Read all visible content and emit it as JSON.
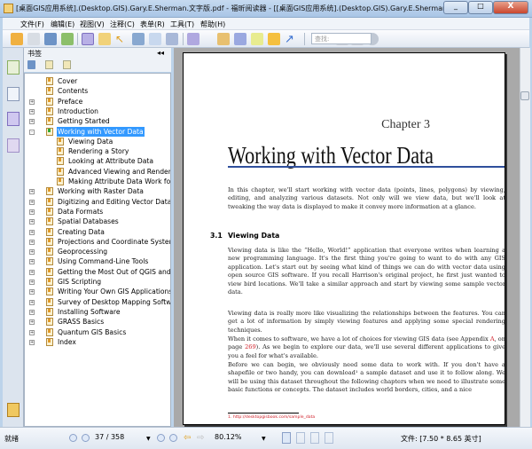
{
  "window": {
    "title": "[桌面GIS应用系统].(Desktop.GIS).Gary.E.Sherman.文字版.pdf - 福昕阅读器 - [[桌面GIS应用系统].(Desktop.GIS).Gary.E.Sherman.文字版.pdf]",
    "close": "X",
    "min": "_",
    "max": "□"
  },
  "menu": [
    "文件(F)",
    "编辑(E)",
    "视图(V)",
    "注释(C)",
    "表单(R)",
    "工具(T)",
    "帮助(H)"
  ],
  "toolbar": {
    "search_placeholder": "查找:",
    "icons": [
      "open-icon",
      "save-icon",
      "print-icon",
      "email-icon",
      "hand-icon",
      "select-text-icon",
      "select-icon",
      "find-icon",
      "typewriter-icon",
      "snapshot-icon",
      "pen-icon",
      "stamp-icon",
      "note-icon",
      "textbox-icon",
      "comment-icon",
      "arrow-icon",
      "find-prev-icon",
      "find-next-icon",
      "search-icon"
    ]
  },
  "bookmarks": {
    "title": "书签",
    "pin": "◂◂",
    "items": [
      {
        "label": "Cover",
        "level": 0,
        "expand": ""
      },
      {
        "label": "Contents",
        "level": 0,
        "expand": ""
      },
      {
        "label": "Preface",
        "level": 0,
        "expand": "+"
      },
      {
        "label": "Introduction",
        "level": 0,
        "expand": "+"
      },
      {
        "label": "Getting Started",
        "level": 0,
        "expand": "+"
      },
      {
        "label": "Working with Vector Data",
        "level": 0,
        "expand": "-",
        "selected": true
      },
      {
        "label": "Viewing Data",
        "level": 1,
        "expand": ""
      },
      {
        "label": "Rendering a Story",
        "level": 1,
        "expand": ""
      },
      {
        "label": "Looking at Attribute Data",
        "level": 1,
        "expand": ""
      },
      {
        "label": "Advanced Viewing and Rendering",
        "level": 1,
        "expand": ""
      },
      {
        "label": "Making Attribute Data Work for You",
        "level": 1,
        "expand": ""
      },
      {
        "label": "Working with Raster Data",
        "level": 0,
        "expand": "+"
      },
      {
        "label": "Digitizing and Editing Vector Data",
        "level": 0,
        "expand": "+"
      },
      {
        "label": "Data Formats",
        "level": 0,
        "expand": "+"
      },
      {
        "label": "Spatial Databases",
        "level": 0,
        "expand": "+"
      },
      {
        "label": "Creating Data",
        "level": 0,
        "expand": "+"
      },
      {
        "label": "Projections and Coordinate Systems",
        "level": 0,
        "expand": "+"
      },
      {
        "label": "Geoprocessing",
        "level": 0,
        "expand": "+"
      },
      {
        "label": "Using Command-Line Tools",
        "level": 0,
        "expand": "+"
      },
      {
        "label": "Getting the Most Out of QGIS and GRASS",
        "level": 0,
        "expand": "+"
      },
      {
        "label": "GIS Scripting",
        "level": 0,
        "expand": "+"
      },
      {
        "label": "Writing Your Own GIS Applications",
        "level": 0,
        "expand": "+"
      },
      {
        "label": "Survey of Desktop Mapping Software",
        "level": 0,
        "expand": "+"
      },
      {
        "label": "Installing Software",
        "level": 0,
        "expand": "+"
      },
      {
        "label": "GRASS Basics",
        "level": 0,
        "expand": "+"
      },
      {
        "label": "Quantum GIS Basics",
        "level": 0,
        "expand": "+"
      },
      {
        "label": "Index",
        "level": 0,
        "expand": "+"
      }
    ]
  },
  "page": {
    "chapter": "Chapter 3",
    "title": "Working with Vector Data",
    "intro": "In this chapter, we'll start working with vector data (points, lines, polygons) by viewing, editing, and analyzing various datasets. Not only will we view data, but we'll look at tweaking the way data is displayed to make it convey more information at a glance.",
    "section_num": "3.1",
    "section_title": "Viewing Data",
    "p1": "Viewing data is like the “Hello, World!” application that everyone writes when learning a new programming language. It's the first thing you're going to want to do with any GIS application. Let's start out by seeing what kind of things we can do with vector data using open source GIS software. If you recall Harrison's original project, he first just wanted to view bird locations. We'll take a similar approach and start by viewing some sample vector data.",
    "p2": "Viewing data is really more like visualizing the relationships between the features. You can get a lot of information by simply viewing features and applying some special rendering techniques.",
    "p3a": "When it comes to software, we have a lot of choices for viewing GIS data (see Appendix ",
    "p3_link1": "A",
    "p3b": ", on page ",
    "p3_link2": "269",
    "p3c": "). As we begin to explore our data, we'll use several different applications to give you a feel for what's available.",
    "p4": "Before we can begin, we obviously need some data to work with. If you don't have a shapefile or two handy, you can download¹ a sample dataset and use it to follow along. We will be using this dataset throughout the following chapters when we need to illustrate some basic functions or concepts. The dataset includes world borders, cities, and a nice",
    "footnote": "1.   http://desktopgisbook.com/sample_data"
  },
  "status": {
    "ready": "就绪",
    "page": "37 / 358",
    "zoom": "80.12%",
    "filesize": "文件: [7.50 * 8.65 英寸]"
  },
  "colors": {
    "accent": "#3399ff",
    "rule": "#2f4f9c",
    "link": "#d0202a"
  }
}
